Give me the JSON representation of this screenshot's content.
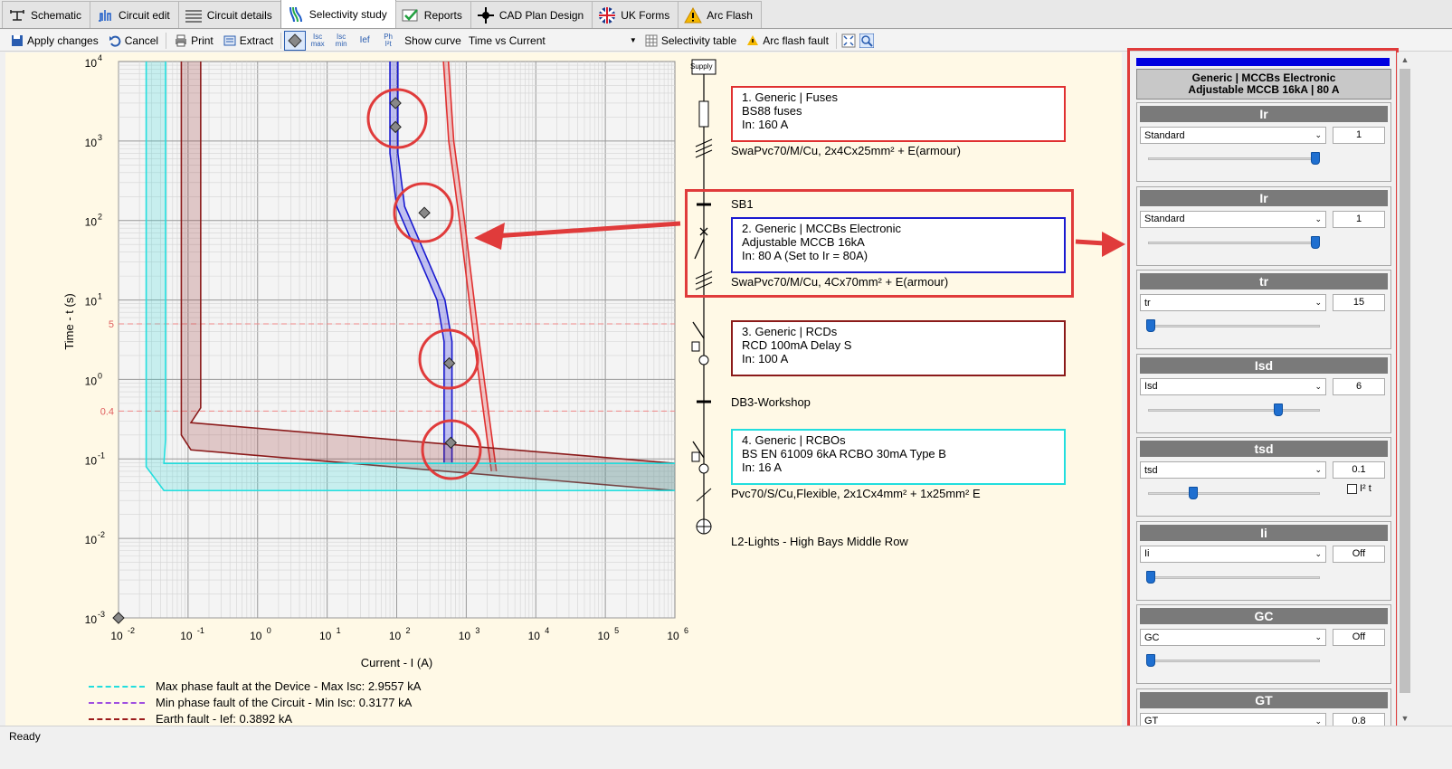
{
  "tabs": [
    {
      "label": "Schematic",
      "icon": "schematic-icon"
    },
    {
      "label": "Circuit edit",
      "icon": "circuit-edit-icon"
    },
    {
      "label": "Circuit details",
      "icon": "list-icon"
    },
    {
      "label": "Selectivity study",
      "icon": "selectivity-icon"
    },
    {
      "label": "Reports",
      "icon": "check-icon"
    },
    {
      "label": "CAD Plan Design",
      "icon": "crosshair-icon"
    },
    {
      "label": "UK Forms",
      "icon": "uk-flag-icon"
    },
    {
      "label": "Arc Flash",
      "icon": "warning-icon"
    }
  ],
  "active_tab": "Selectivity study",
  "toolbar": {
    "apply": "Apply changes",
    "cancel": "Cancel",
    "print": "Print",
    "extract": "Extract",
    "isc_max": "Isc max",
    "isc_min": "Isc min",
    "ief": "Ief",
    "ph_i2t": "Ph I²t",
    "show_curve_label": "Show curve",
    "show_curve_value": "Time vs Current",
    "selectivity_table": "Selectivity table",
    "arc_flash_fault": "Arc flash fault"
  },
  "chart": {
    "ylabel": "Time - t (s)",
    "xlabel": "Current - I (A)",
    "x_exponents": [
      "-2",
      "-1",
      "0",
      "1",
      "2",
      "3",
      "4",
      "5",
      "6"
    ],
    "y_exponents": [
      "4",
      "3",
      "2",
      "1",
      "0",
      "-1",
      "-2",
      "-3"
    ],
    "ref_lines": [
      "5",
      "0.4"
    ]
  },
  "chart_data": {
    "type": "line",
    "xlabel": "Current - I (A)",
    "ylabel": "Time - t (s)",
    "xscale": "log",
    "yscale": "log",
    "xlim": [
      0.01,
      1000000
    ],
    "ylim": [
      0.001,
      10000
    ],
    "reference_lines_s": [
      5,
      0.4
    ],
    "grid": true,
    "series": [
      {
        "name": "1. Generic | Fuses",
        "color": "#e03030",
        "x": [
          470,
          560,
          800,
          1300,
          2300
        ],
        "y": [
          10000,
          1000,
          100,
          3,
          0.07
        ]
      },
      {
        "name": "2. Generic | MCCBs Electronic",
        "color": "#1a1ad0",
        "x": [
          80,
          80,
          100,
          380,
          480,
          480
        ],
        "y": [
          10000,
          700,
          150,
          10,
          3,
          0.09
        ]
      },
      {
        "name": "3. Generic | RCDs",
        "color": "#8b1a1a",
        "x": [
          0.08,
          0.08,
          0.11,
          1000000
        ],
        "y": [
          10000,
          0.2,
          0.13,
          0.04
        ]
      },
      {
        "name": "4. Generic | RCBOs",
        "color": "#22dede",
        "x": [
          0.025,
          0.025,
          0.045,
          1000000
        ],
        "y": [
          10000,
          0.08,
          0.04,
          0.04
        ]
      }
    ],
    "markers": [
      {
        "x": 96,
        "y": 3000
      },
      {
        "x": 96,
        "y": 1500
      },
      {
        "x": 250,
        "y": 125
      },
      {
        "x": 570,
        "y": 1.6
      },
      {
        "x": 600,
        "y": 0.16
      },
      {
        "x": 0.01,
        "y": 0.001
      }
    ]
  },
  "single_line": {
    "supply": "Supply",
    "devices": [
      {
        "l1": "1. Generic | Fuses",
        "l2": "BS88 fuses",
        "l3": "In: 160 A"
      },
      {
        "l1": "2. Generic | MCCBs Electronic",
        "l2": "Adjustable MCCB 16kA",
        "l3": "In: 80 A (Set to Ir = 80A)"
      },
      {
        "l1": "3. Generic | RCDs",
        "l2": "RCD 100mA Delay S",
        "l3": "In: 100 A"
      },
      {
        "l1": "4. Generic | RCBOs",
        "l2": "BS EN 61009 6kA RCBO 30mA Type B",
        "l3": "In: 16 A"
      }
    ],
    "cable1": "SwaPvc70/M/Cu, 2x4Cx25mm² + E(armour)",
    "sb1": "SB1",
    "cable2": "SwaPvc70/M/Cu, 4Cx70mm² + E(armour)",
    "db": "DB3-Workshop",
    "cable3": "Pvc70/S/Cu,Flexible, 2x1Cx4mm² + 1x25mm² E",
    "load": "L2-Lights - High Bays Middle Row"
  },
  "legend": [
    {
      "label": "Max phase fault at the Device - Max Isc: 2.9557 kA",
      "color": "#22dede"
    },
    {
      "label": "Min phase fault of the Circuit - Min Isc: 0.3177 kA",
      "color": "#a050e0"
    },
    {
      "label": "Earth fault - Ief: 0.3892 kA",
      "color": "#9b1a1a"
    }
  ],
  "panel": {
    "title_l1": "Generic | MCCBs Electronic",
    "title_l2": "Adjustable MCCB 16kA | 80 A",
    "sections": [
      {
        "header": "Ir",
        "dropdown": "Standard",
        "value": "1",
        "slider_fraction": 0.97
      },
      {
        "header": "Ir",
        "dropdown": "Standard",
        "value": "1",
        "slider_fraction": 0.97
      },
      {
        "header": "tr",
        "dropdown": "tr",
        "value": "15",
        "slider_fraction": 0.0
      },
      {
        "header": "Isd",
        "dropdown": "Isd",
        "value": "6",
        "slider_fraction": 0.75
      },
      {
        "header": "tsd",
        "dropdown": "tsd",
        "value": "0.1",
        "slider_fraction": 0.25,
        "checkbox": "I² t"
      },
      {
        "header": "Ii",
        "dropdown": "Ii",
        "value": "Off",
        "slider_fraction": 0.0
      },
      {
        "header": "GC",
        "dropdown": "GC",
        "value": "Off",
        "slider_fraction": 0.0
      },
      {
        "header": "GT",
        "dropdown": "GT",
        "value": "0.8",
        "slider_fraction": 0.0
      }
    ]
  },
  "status": "Ready",
  "colors": {
    "highlight": "#e03b3b",
    "panel_accent": "#0000e0",
    "chart_bg": "#fff9e6"
  }
}
